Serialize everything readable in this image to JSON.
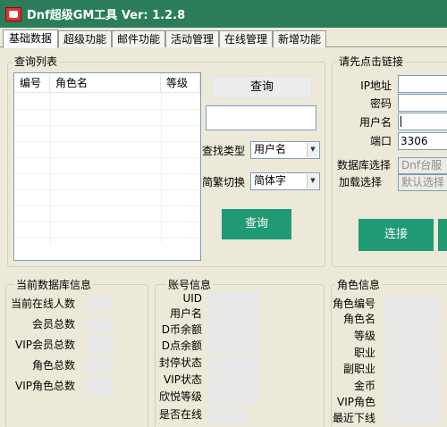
{
  "window": {
    "title": "Dnf超级GM工具 Ver:  1.2.8"
  },
  "tabs": [
    "基础数据",
    "超级功能",
    "邮件功能",
    "活动管理",
    "在线管理",
    "新增功能"
  ],
  "query_panel": {
    "title": "查询列表",
    "columns": [
      "编号",
      "角色名",
      "等级"
    ],
    "top_query_label": "查询",
    "search_value": "",
    "type_label": "查找类型",
    "type_value": "用户名",
    "charset_label": "简繁切换",
    "charset_value": "简体字",
    "query_button": "查询"
  },
  "connect_panel": {
    "title": "请先点击链接",
    "ip_label": "IP地址",
    "ip_value": "",
    "password_label": "密码",
    "password_value": "",
    "username_label": "用户名",
    "username_value": "",
    "port_label": "端口",
    "port_value": "3306",
    "db_label": "数据库选择",
    "db_value": "Dnf台服",
    "load_label": "加载选择",
    "load_value": "默认选择",
    "connect_button": "连接"
  },
  "db_info": {
    "title": "当前数据库信息",
    "online": "当前在线人数",
    "members": "会员总数",
    "vip_members": "VIP会员总数",
    "roles": "角色总数",
    "vip_roles": "VIP角色总数"
  },
  "account_info": {
    "title": "账号信息",
    "uid": "UID",
    "username": "用户名",
    "d_coin": "D币余额",
    "d_point": "D点余额",
    "ban_status": "封停状态",
    "vip_status": "VIP状态",
    "joy_level": "欣悦等级",
    "online": "是否在线"
  },
  "role_info": {
    "title": "角色信息",
    "role_id": "角色编号",
    "role_name": "角色名",
    "level": "等级",
    "job": "职业",
    "sub_job": "副职业",
    "gold": "金币",
    "vip_role": "VIP角色",
    "last_offline": "最近下线"
  }
}
